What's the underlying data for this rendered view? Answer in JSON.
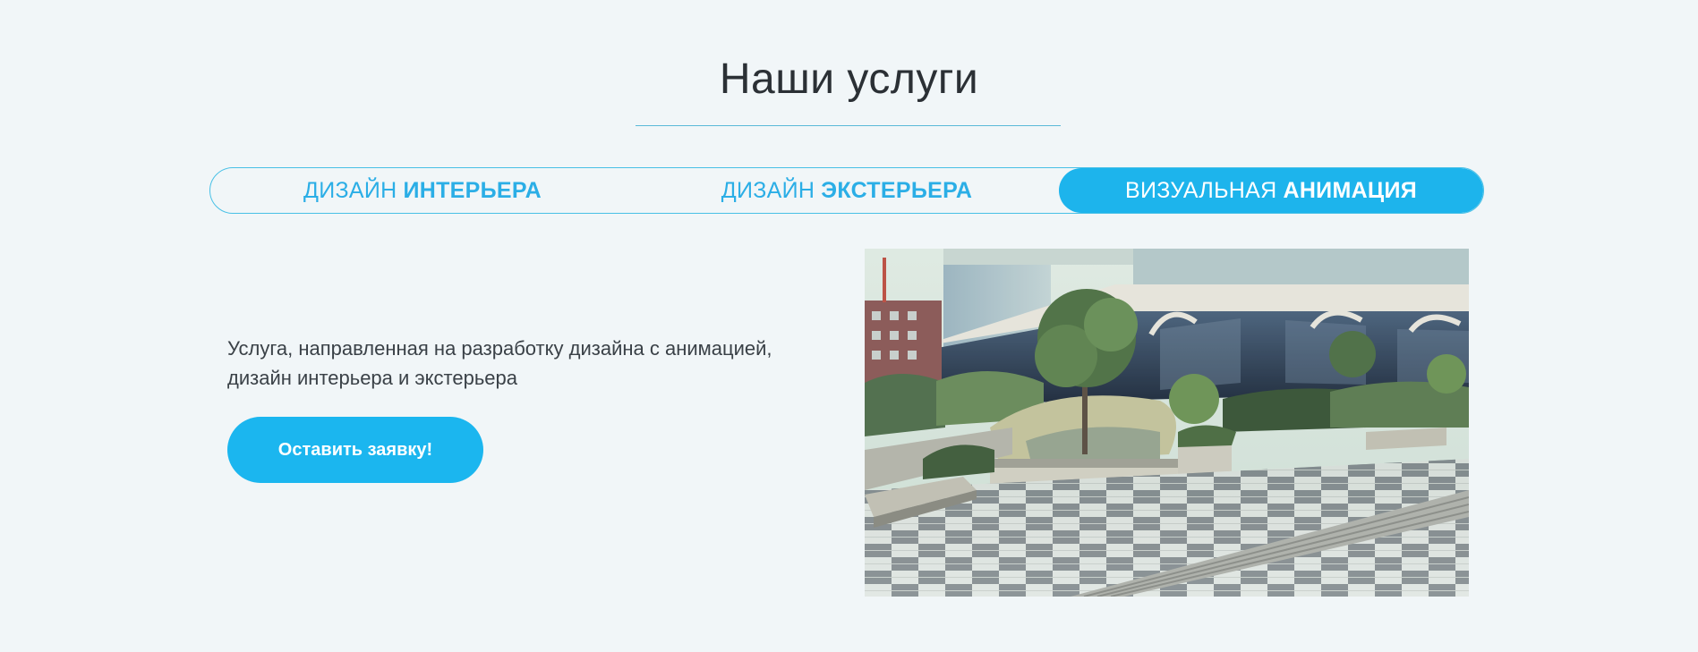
{
  "section": {
    "title": "Наши услуги"
  },
  "tabs": [
    {
      "label_normal": "ДИЗАЙН",
      "label_bold": "ИНТЕРЬЕРА",
      "active": false
    },
    {
      "label_normal": "ДИЗАЙН",
      "label_bold": "ЭКСТЕРЬЕРА",
      "active": false
    },
    {
      "label_normal": "ВИЗУАЛЬНАЯ",
      "label_bold": "АНИМАЦИЯ",
      "active": true
    }
  ],
  "content": {
    "description_line1": "Услуга, направленная на разработку дизайна с анимацией,",
    "description_line2": "дизайн интерьера и экстерьера",
    "cta_label": "Оставить заявку!"
  },
  "colors": {
    "accent": "#1db4ec",
    "background": "#f1f6f8",
    "text": "#333d44"
  }
}
